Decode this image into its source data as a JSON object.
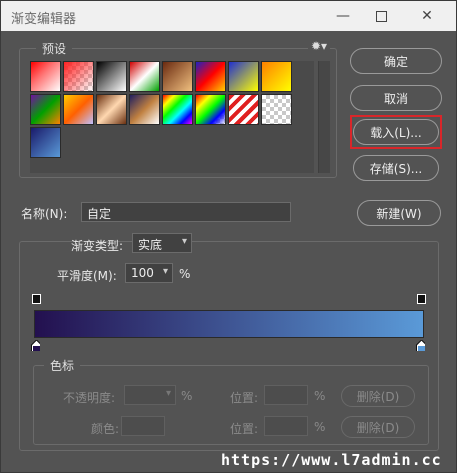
{
  "window": {
    "title": "渐变编辑器"
  },
  "presets": {
    "legend": "预设",
    "swatches": [
      {
        "row": 0,
        "col": 0,
        "bg": "linear-gradient(135deg,#ff0000,#ff7070 40%,#ffffff)"
      },
      {
        "row": 0,
        "col": 1,
        "bg": "linear-gradient(135deg,#ff2020,#ffffff00),repeating-conic-gradient(#ccc 0 25%,#fff 0 50%) 0 0/8px 8px"
      },
      {
        "row": 0,
        "col": 2,
        "bg": "linear-gradient(135deg,#000000,#ffffff)"
      },
      {
        "row": 0,
        "col": 3,
        "bg": "linear-gradient(135deg,#d00000,#ffffff 50%,#00a000)"
      },
      {
        "row": 0,
        "col": 4,
        "bg": "linear-gradient(135deg,#6a2a10,#f0c080)"
      },
      {
        "row": 0,
        "col": 5,
        "bg": "linear-gradient(135deg,#2020c0,#ff0000 50%,#ffd000)"
      },
      {
        "row": 0,
        "col": 6,
        "bg": "linear-gradient(135deg,#2030d0,#ffff00)"
      },
      {
        "row": 0,
        "col": 7,
        "bg": "linear-gradient(135deg,#ff8000,#ffff00)"
      },
      {
        "row": 1,
        "col": 0,
        "bg": "linear-gradient(135deg,#7010a0,#00a000 50%,#ff8000)"
      },
      {
        "row": 1,
        "col": 1,
        "bg": "linear-gradient(135deg,#ffcc00,#ff6000 50%,#c0c0ff)"
      },
      {
        "row": 1,
        "col": 2,
        "bg": "linear-gradient(135deg,#6a3010,#ffd8b0 50%,#6a3010)"
      },
      {
        "row": 1,
        "col": 3,
        "bg": "linear-gradient(135deg,#202060,#c08040 50%,#ffffff)"
      },
      {
        "row": 1,
        "col": 4,
        "bg": "linear-gradient(135deg,#ff0000,#ffff00 20%,#00ff00 40%,#00ffff 60%,#0000ff 80%,#ff00ff)"
      },
      {
        "row": 1,
        "col": 5,
        "bg": "linear-gradient(135deg,#ff0000,#ffff00 25%,#00ff00 50%,#0000ff 75%,#ffffff00),repeating-conic-gradient(#ccc 0 25%,#fff 0 50%) 0 0/8px 8px"
      },
      {
        "row": 1,
        "col": 6,
        "bg": "repeating-linear-gradient(135deg,#e02020 0 4px,#ffffff 4px 8px)"
      },
      {
        "row": 1,
        "col": 7,
        "bg": "repeating-conic-gradient(#c8c8c8 0 25%,#ffffff 0 50%) 0 0/8px 8px"
      },
      {
        "row": 2,
        "col": 0,
        "bg": "linear-gradient(135deg,#1a1a6a,#5a9ad8)"
      }
    ]
  },
  "buttons": {
    "ok": "确定",
    "cancel": "取消",
    "load": "载入(L)...",
    "save": "存储(S)...",
    "new": "新建(W)"
  },
  "name": {
    "label": "名称(N):",
    "value": "自定"
  },
  "gradient": {
    "type_label": "渐变类型:",
    "type_value": "实底",
    "smooth_label": "平滑度(M):",
    "smooth_value": "100",
    "smooth_unit": "%",
    "start_color": "#23104f",
    "end_color": "#5a9ad8",
    "end_stop_color": "#5a9ad8"
  },
  "color_stops": {
    "legend": "色标",
    "opacity_label": "不透明度:",
    "opacity_unit": "%",
    "location_label": "位置:",
    "location_unit": "%",
    "delete_label": "删除(D)",
    "color_label": "颜色:",
    "location2_label": "位置:",
    "location2_unit": "%",
    "delete2_label": "删除(D)"
  },
  "watermark": "https://www.l7admin.cc"
}
